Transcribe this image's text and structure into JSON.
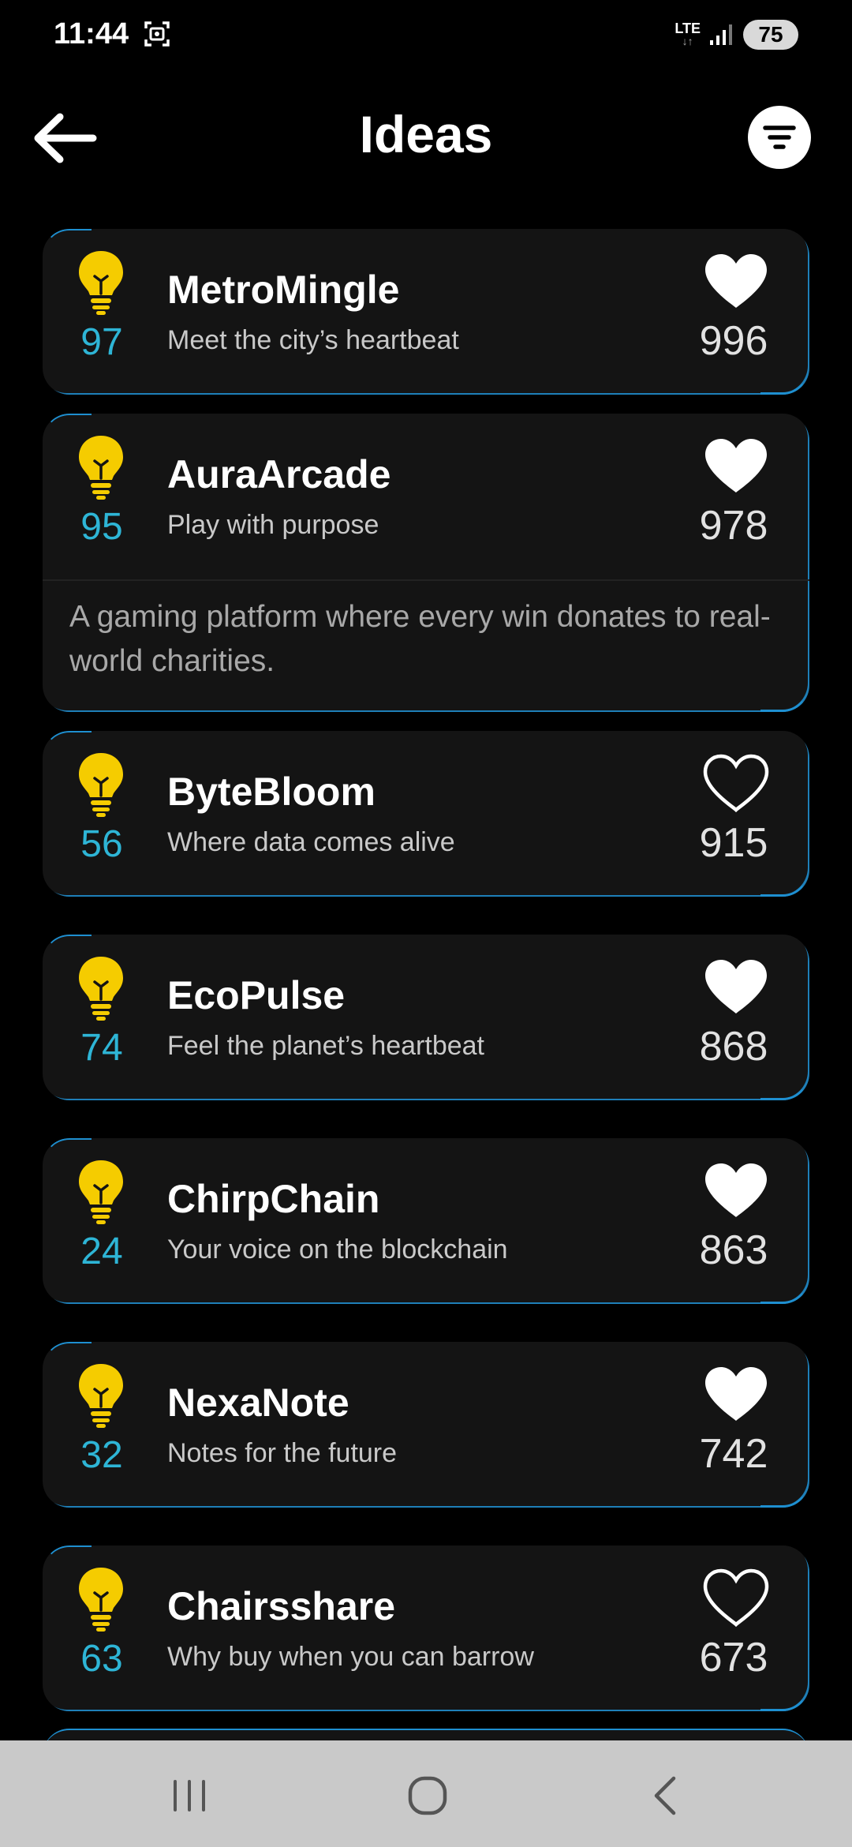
{
  "status_bar": {
    "time": "11:44",
    "network": "LTE",
    "network_arrows": "↓↑",
    "battery": "75"
  },
  "header": {
    "title": "Ideas",
    "back_icon": "arrow-left-icon",
    "filter_icon": "filter-icon"
  },
  "colors": {
    "background": "#000000",
    "card": "#141414",
    "accent_blue": "#2eb5d6",
    "bulb_yellow": "#f5cc00",
    "edge_blue": "#1e8fd0"
  },
  "ideas": [
    {
      "title": "MetroMingle",
      "tagline": "Meet the city’s heartbeat",
      "score": "97",
      "likes": "996",
      "liked": true
    },
    {
      "title": "AuraArcade",
      "tagline": "Play with purpose",
      "score": "95",
      "likes": "978",
      "liked": true,
      "description": "A gaming platform where every win donates to real-world charities."
    },
    {
      "title": "ByteBloom",
      "tagline": "Where data comes alive",
      "score": "56",
      "likes": "915",
      "liked": false
    },
    {
      "title": "EcoPulse",
      "tagline": "Feel the planet’s heartbeat",
      "score": "74",
      "likes": "868",
      "liked": true
    },
    {
      "title": "ChirpChain",
      "tagline": "Your voice on the blockchain",
      "score": "24",
      "likes": "863",
      "liked": true
    },
    {
      "title": "NexaNote",
      "tagline": "Notes for the future",
      "score": "32",
      "likes": "742",
      "liked": true
    },
    {
      "title": "Chairsshare",
      "tagline": "Why buy when you can barrow",
      "score": "63",
      "likes": "673",
      "liked": false
    }
  ],
  "nav_bar": {
    "recent_icon": "recent-apps-icon",
    "home_icon": "home-icon",
    "back_icon": "back-icon"
  }
}
